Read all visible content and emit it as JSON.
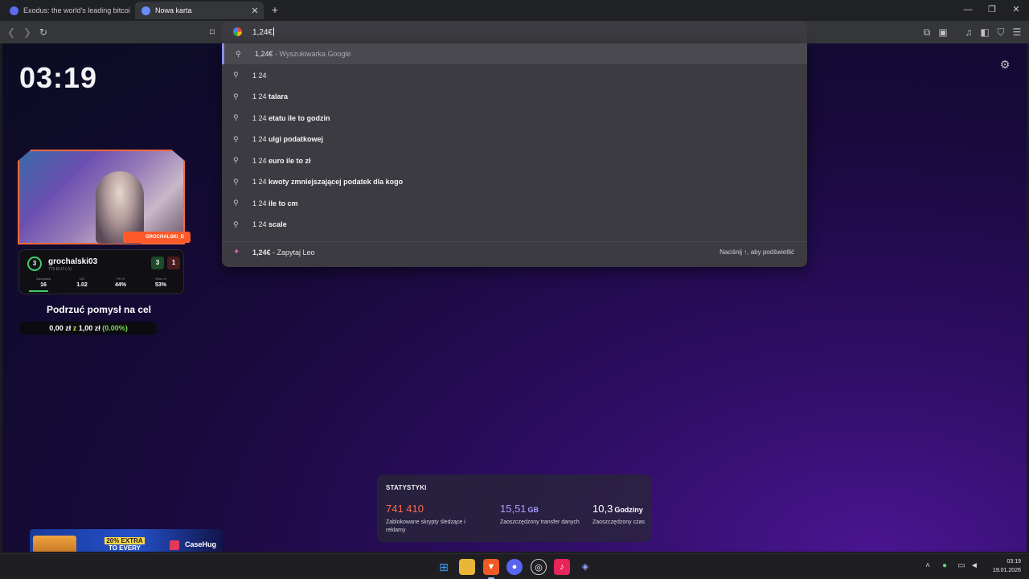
{
  "tabs": [
    {
      "title": "Exodus: the world's leading bitcoin and",
      "active": false
    },
    {
      "title": "Nowa karta",
      "active": true
    }
  ],
  "omnibox": {
    "text": "1,24€"
  },
  "suggestions": [
    {
      "query": "1,24€",
      "suffix": "Wyszukiwarka Google"
    },
    {
      "prefix": "1 24",
      "bold": ""
    },
    {
      "prefix": "1 24",
      "bold": "talara"
    },
    {
      "prefix": "1 24",
      "bold": "etatu ile to godzin"
    },
    {
      "prefix": "1 24",
      "bold": "ulgi podatkowej"
    },
    {
      "prefix": "1 24",
      "bold": "euro ile to zł"
    },
    {
      "prefix": "1 24",
      "bold": "kwoty zmniejszającej podatek dla kogo"
    },
    {
      "prefix": "1 24",
      "bold": "ile to cm"
    },
    {
      "prefix": "1 24",
      "bold": "scale"
    }
  ],
  "leo": {
    "query": "1,24€",
    "suffix": "Zapytaj Leo",
    "hint": "Naciśnij ↑, aby podświetlić"
  },
  "clock": "03:19",
  "player": {
    "level": "3",
    "name": "grochalski03",
    "elo": "773 ELO (-1)",
    "wins": "3",
    "losses": "1",
    "stats": [
      {
        "label": "Zabójstwa",
        "value": "16"
      },
      {
        "label": "K/D",
        "value": "1.02"
      },
      {
        "label": "HS %",
        "value": "44%"
      },
      {
        "label": "Wins %",
        "value": "53%"
      }
    ]
  },
  "cam": {
    "social": "GROCHALSKI_D",
    "logo": "Grochalski"
  },
  "goal": {
    "title": "Podrzuć pomysł na cel",
    "current": "0,00 zł",
    "sep": "z",
    "target": "1,00 zł",
    "percent": "(0.00%)"
  },
  "banner": {
    "line1": "20% EXTRA",
    "line2": "TO EVERY TOP-UP",
    "brand": "CaseHug"
  },
  "stats": {
    "title": "STATYSTYKI",
    "items": [
      {
        "value": "741 410",
        "unit": "",
        "desc": "Zablokowane skrypty śledzące i reklamy",
        "color": "#ff6b4a"
      },
      {
        "value": "15,51",
        "unit": "GB",
        "desc": "Zaoszczędzony transfer danych",
        "color": "#a59bff"
      },
      {
        "value": "10,3",
        "unit": "Godziny",
        "desc": "Zaoszczędzony czas",
        "color": "#ffffff"
      }
    ]
  },
  "taskbar": {
    "time": "03:19",
    "date": "19.01.2026"
  }
}
